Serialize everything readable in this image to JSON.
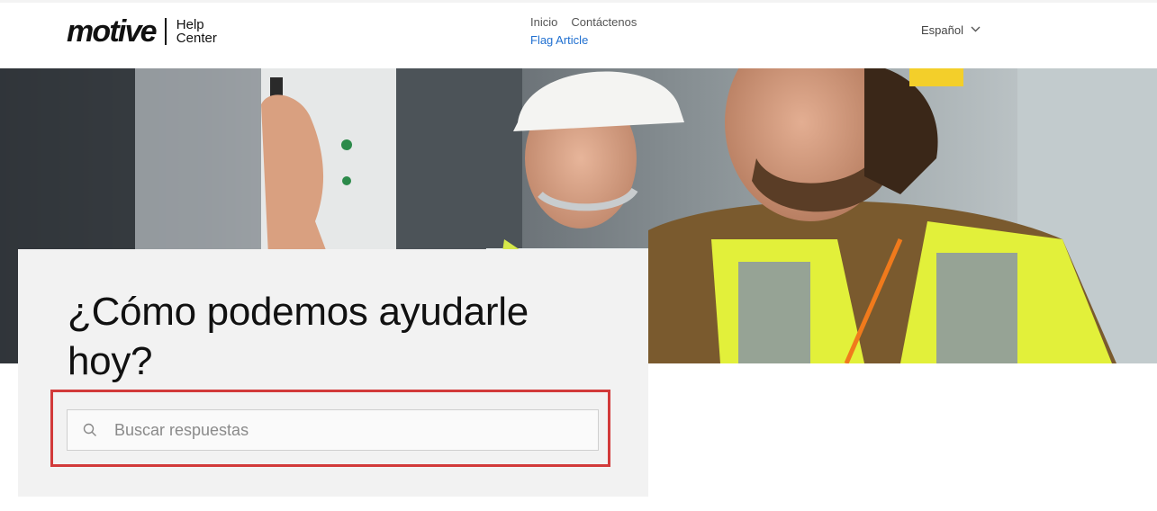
{
  "header": {
    "logo_word": "motive",
    "logo_sub_1": "Help",
    "logo_sub_2": "Center",
    "nav": {
      "home": "Inicio",
      "contact": "Contáctenos",
      "flag": "Flag Article"
    },
    "language": "Español"
  },
  "hero": {
    "image": "two-workers-in-hard-hats-and-safety-vests-photo"
  },
  "main": {
    "title": "¿Cómo podemos ayudarle hoy?",
    "search_placeholder": "Buscar respuestas"
  },
  "icons": {
    "search": "search-icon",
    "chevron": "chevron-down-icon"
  },
  "colors": {
    "link_accent": "#1f6fd0",
    "highlight_border": "#d23a3a",
    "panel_bg": "#f2f2f2"
  }
}
